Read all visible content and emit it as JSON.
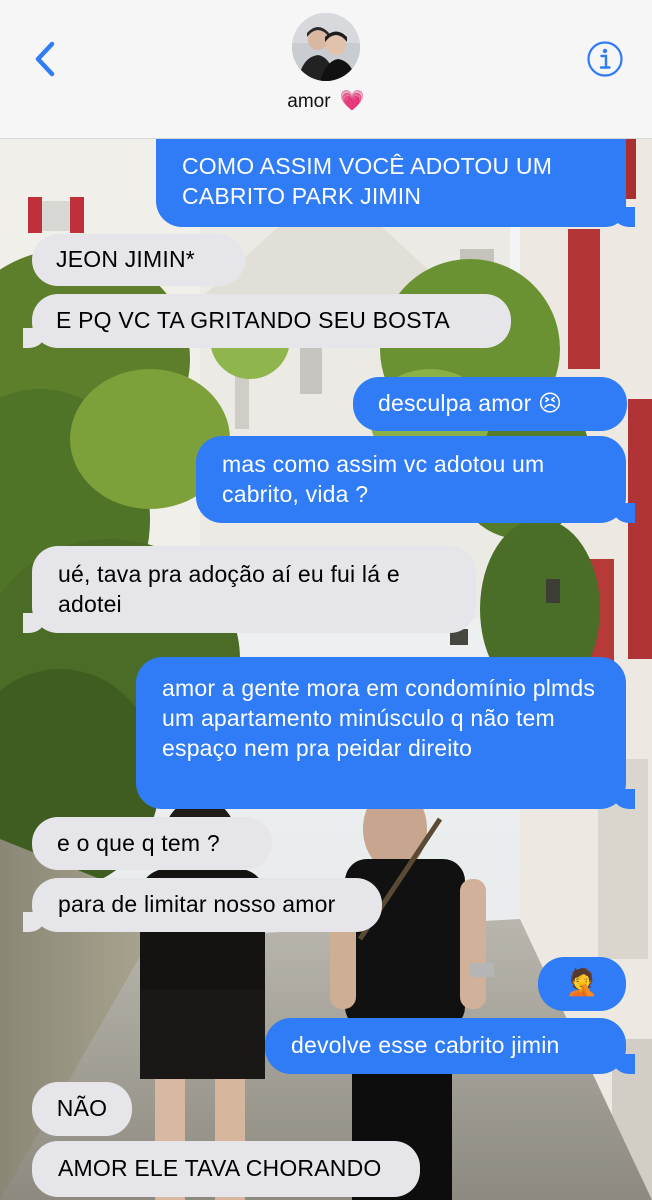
{
  "header": {
    "contact_name": "amor",
    "contact_emoji": "💗",
    "back_icon": "chevron-left-icon",
    "info_icon": "info-icon"
  },
  "colors": {
    "accent": "#2f7cf6",
    "received_bubble": "#e6e6ea",
    "sent_bubble": "#2f7cf6"
  },
  "messages": [
    {
      "from": "me",
      "text": "COMO ASSIM VOCÊ ADOTOU UM CABRITO PARK JIMIN"
    },
    {
      "from": "them",
      "text": "JEON JIMIN*"
    },
    {
      "from": "them",
      "text": "E PQ VC TA GRITANDO SEU BOSTA"
    },
    {
      "from": "me",
      "text": "desculpa amor 😣"
    },
    {
      "from": "me",
      "text": "mas como assim vc adotou um cabrito, vida ?"
    },
    {
      "from": "them",
      "text": "ué, tava pra adoção aí eu fui lá e adotei"
    },
    {
      "from": "me",
      "text": "amor a gente mora em condomínio plmds um apartamento minúsculo q não tem espaço nem pra peidar direito"
    },
    {
      "from": "them",
      "text": "e o que q tem ?"
    },
    {
      "from": "them",
      "text": "para de limitar nosso amor"
    },
    {
      "from": "me",
      "text": "🤦"
    },
    {
      "from": "me",
      "text": "devolve esse cabrito jimin"
    },
    {
      "from": "them",
      "text": "NÃO"
    },
    {
      "from": "them",
      "text": "AMOR ELE TAVA CHORANDO"
    }
  ]
}
